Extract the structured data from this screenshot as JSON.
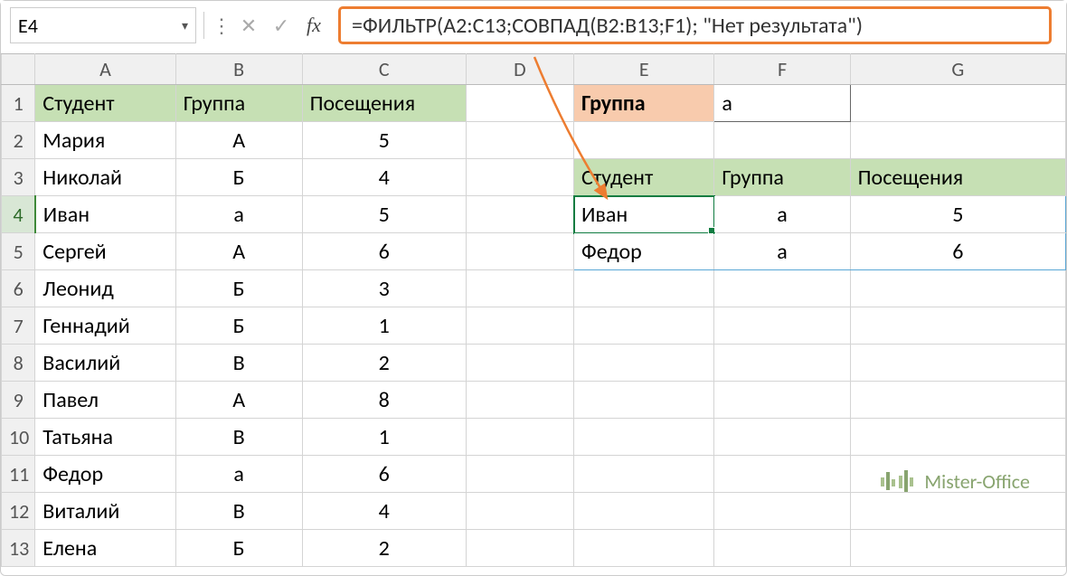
{
  "namebox": "E4",
  "formula": "=ФИЛЬТР(A2:C13;СОВПАД(B2:B13;F1); \"Нет результата\")",
  "columns": [
    "A",
    "B",
    "C",
    "D",
    "E",
    "F",
    "G"
  ],
  "rows": [
    "1",
    "2",
    "3",
    "4",
    "5",
    "6",
    "7",
    "8",
    "9",
    "10",
    "11",
    "12",
    "13"
  ],
  "headersLeft": {
    "A": "Студент",
    "B": "Группа",
    "C": "Посещения"
  },
  "dataLeft": [
    {
      "A": "Мария",
      "B": "А",
      "C": "5"
    },
    {
      "A": "Николай",
      "B": "Б",
      "C": "4"
    },
    {
      "A": "Иван",
      "B": "а",
      "C": "5"
    },
    {
      "A": "Сергей",
      "B": "А",
      "C": "6"
    },
    {
      "A": "Леонид",
      "B": "Б",
      "C": "3"
    },
    {
      "A": "Геннадий",
      "B": "Б",
      "C": "1"
    },
    {
      "A": "Василий",
      "B": "В",
      "C": "2"
    },
    {
      "A": "Павел",
      "B": "А",
      "C": "8"
    },
    {
      "A": "Татьяна",
      "B": "В",
      "C": "1"
    },
    {
      "A": "Федор",
      "B": "а",
      "C": "6"
    },
    {
      "A": "Виталий",
      "B": "В",
      "C": "4"
    },
    {
      "A": "Елена",
      "B": "Б",
      "C": "2"
    }
  ],
  "filterLabel": "Группа",
  "filterValue": "а",
  "headersRight": {
    "E": "Студент",
    "F": "Группа",
    "G": "Посещения"
  },
  "dataRight": [
    {
      "E": "Иван",
      "F": "а",
      "G": "5"
    },
    {
      "E": "Федор",
      "F": "а",
      "G": "6"
    }
  ],
  "watermark": "Mister-Office"
}
